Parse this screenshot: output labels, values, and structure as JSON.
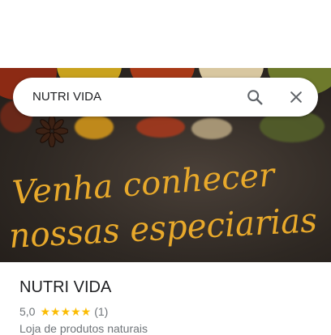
{
  "search": {
    "query": "NUTRI VIDA"
  },
  "hero": {
    "line1": "Venha conhecer",
    "line2": "nossas especiarias",
    "text_color": "#e8a92b"
  },
  "place": {
    "name": "NUTRI VIDA",
    "rating_value": "5,0",
    "stars": "★★★★★",
    "review_count": "(1)",
    "category": "Loja de produtos naturais"
  },
  "icons": {
    "search": "search-icon",
    "close": "close-icon",
    "star": "star-icon"
  },
  "colors": {
    "star": "#fbbc04",
    "hero_bg": "#2e2823",
    "text_primary": "#202124",
    "text_secondary": "#70757a"
  }
}
